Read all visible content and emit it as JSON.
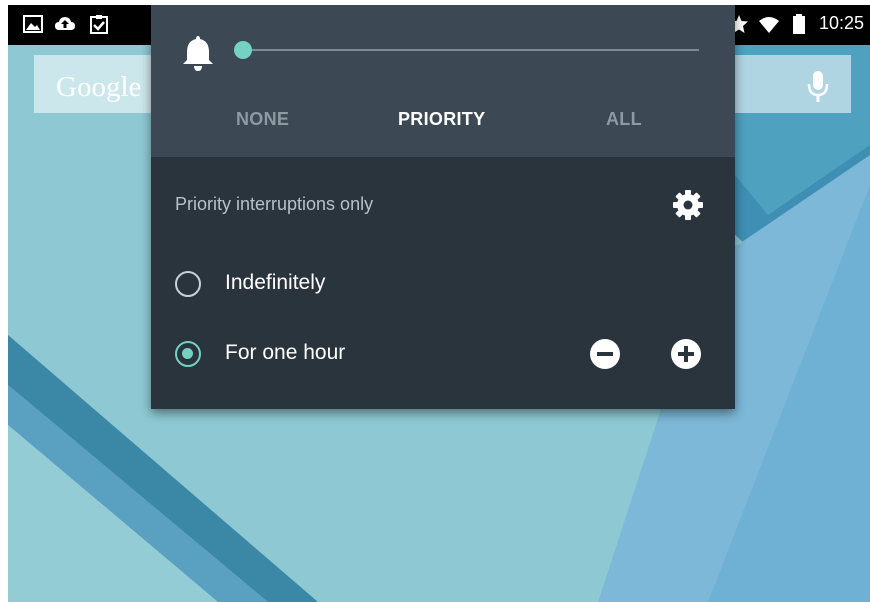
{
  "status_bar": {
    "time": "10:25",
    "left_icons": [
      "image-icon",
      "cloud-upload-icon",
      "clipboard-check-icon"
    ],
    "right_icons": [
      "star-icon",
      "wifi-icon",
      "battery-icon"
    ]
  },
  "home": {
    "search_logo": "Google",
    "search_icon": "mic-icon"
  },
  "interruptions_panel": {
    "volume_icon": "bell-icon",
    "volume_level_fraction": 0.0,
    "modes": [
      {
        "label": "NONE",
        "selected": false
      },
      {
        "label": "PRIORITY",
        "selected": true
      },
      {
        "label": "ALL",
        "selected": false
      }
    ],
    "subtitle": "Priority interruptions only",
    "settings_icon": "gear-icon",
    "durations": [
      {
        "label": "Indefinitely",
        "selected": false
      },
      {
        "label": "For one hour",
        "selected": true
      }
    ],
    "decrease_icon": "minus-circle-icon",
    "increase_icon": "plus-circle-icon"
  },
  "colors": {
    "accent": "#74d1c3",
    "panel_top": "#3c4853",
    "panel_bottom": "#2a343d",
    "wallpaper": "#8ec9d3"
  }
}
